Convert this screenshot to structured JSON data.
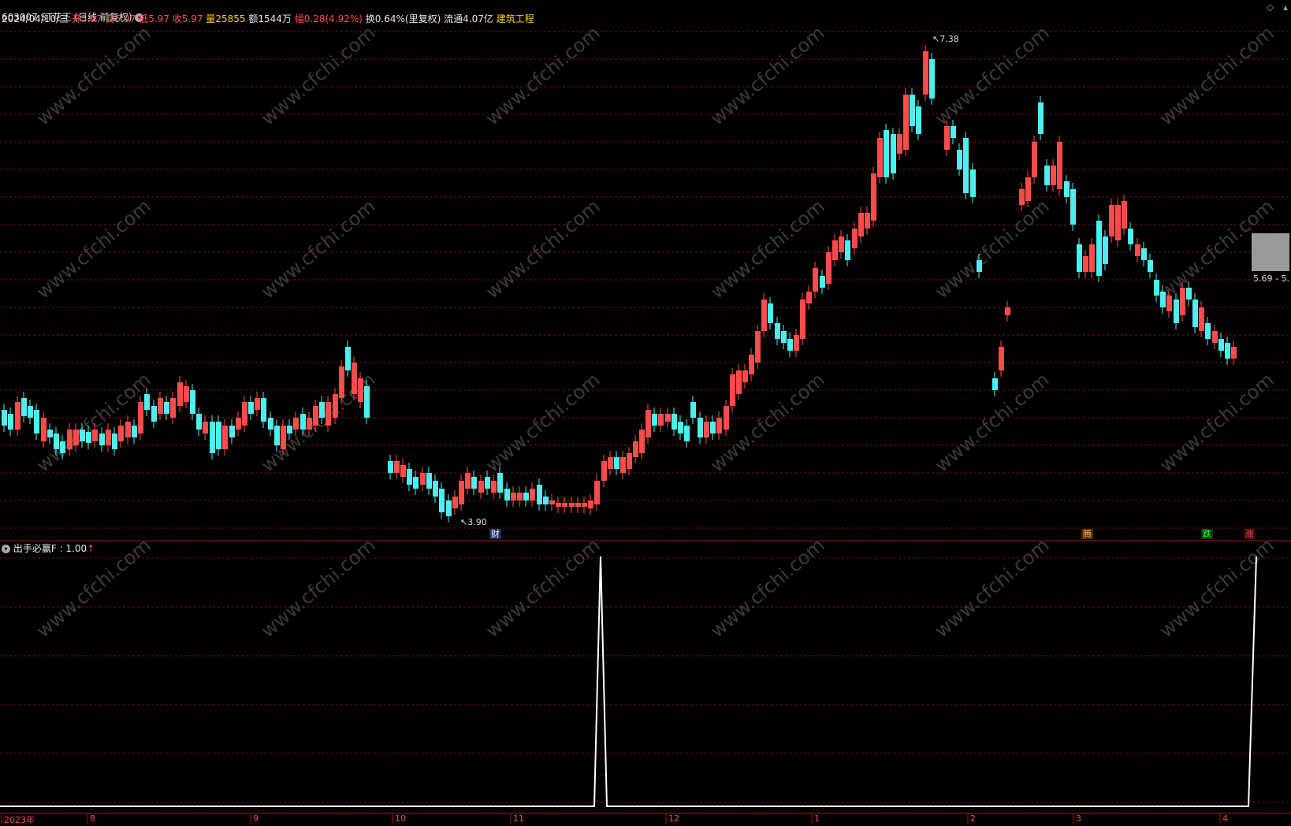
{
  "header": {
    "code": "603007",
    "name": "ST花王",
    "period": "(日线 前复权)",
    "date": "2024/04/10/三",
    "open_label": "开",
    "open": "5.97",
    "high_label": "高",
    "high": "5.97",
    "low_label": "低",
    "low": "5.97",
    "close_label": "收",
    "close": "5.97",
    "vol_label": "量",
    "vol": "25855",
    "amount_label": "额",
    "amount": "1544万",
    "chg_label": "幅",
    "chg": "0.28(4.92%)",
    "turnover_label": "换",
    "turnover": "0.64%(里复权)",
    "float_label": "流通",
    "float": "4.07亿",
    "sector": "建筑工程"
  },
  "markers": {
    "high_price": "7.38",
    "low_price": "3.90",
    "range": "5.69 - 5.",
    "badge_cai": "财",
    "badge_teng": "腾",
    "badge_die": "跌",
    "badge_zhang": "涨"
  },
  "indicator": {
    "name": "出手必赢F",
    "value": ": 1.00",
    "arrow": "↑"
  },
  "x_axis": {
    "labels": [
      "2023年",
      "8",
      "9",
      "10",
      "11",
      "12",
      "1",
      "2",
      "3",
      "4"
    ]
  },
  "watermark": "www.cfchi.com",
  "colors": {
    "up": "#ff4b4b",
    "down": "#4cf0ee",
    "grid": "#7a1010",
    "indicator_line": "#ffffff"
  }
}
